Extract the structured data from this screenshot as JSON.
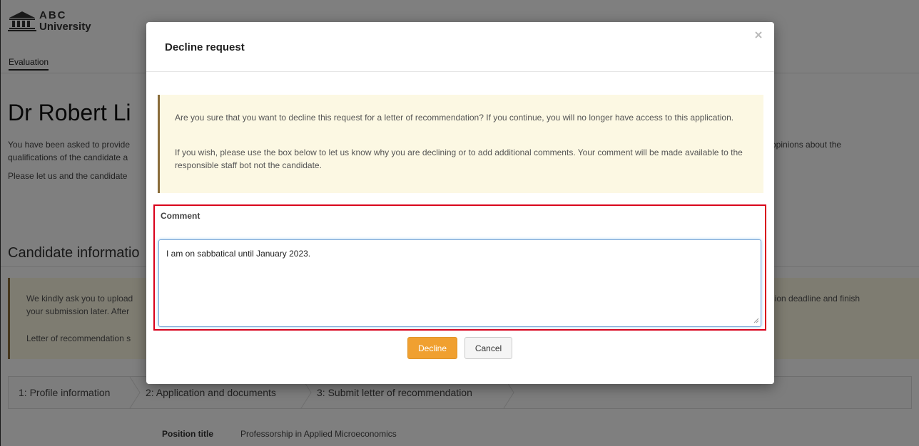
{
  "brand": {
    "abc": "ABC",
    "university": "University"
  },
  "nav": {
    "evaluation_tab": "Evaluation"
  },
  "candidate": {
    "name": "Dr Robert Li",
    "intro_line1": "You have been asked to provide",
    "intro_line2": "qualifications of the candidate a",
    "intro_line3": "Please let us and the candidate",
    "intro_right": "opinions about the"
  },
  "candidate_info": {
    "heading": "Candidate informatio",
    "notice_line1": "We kindly ask you to upload",
    "notice_line2": "your submission later. After",
    "notice_line3": "Letter of recommendation s",
    "notice_right": "ission deadline and finish"
  },
  "steps": [
    {
      "label": "1: Profile information"
    },
    {
      "label": "2: Application and documents"
    },
    {
      "label": "3: Submit letter of recommendation"
    }
  ],
  "position": {
    "label": "Position title",
    "value": "Professorship in Applied Microeconomics"
  },
  "modal": {
    "title": "Decline request",
    "close_icon": "close-icon",
    "alert_p1": "Are you sure that you want to decline this request for a letter of recommendation? If you continue, you will no longer have access to this application.",
    "alert_p2": "If you wish, please use the box below to let us know why you are declining or to add additional comments. Your comment will be made available to the responsible staff bot not the candidate.",
    "comment_label": "Comment",
    "comment_value": "I am on sabbatical until January 2023.",
    "decline_label": "Decline",
    "cancel_label": "Cancel"
  },
  "colors": {
    "accent_orange": "#f0a030",
    "highlight_red": "#d9001b",
    "alert_bg": "#fcf8e3",
    "alert_border": "#8a6d3b"
  }
}
